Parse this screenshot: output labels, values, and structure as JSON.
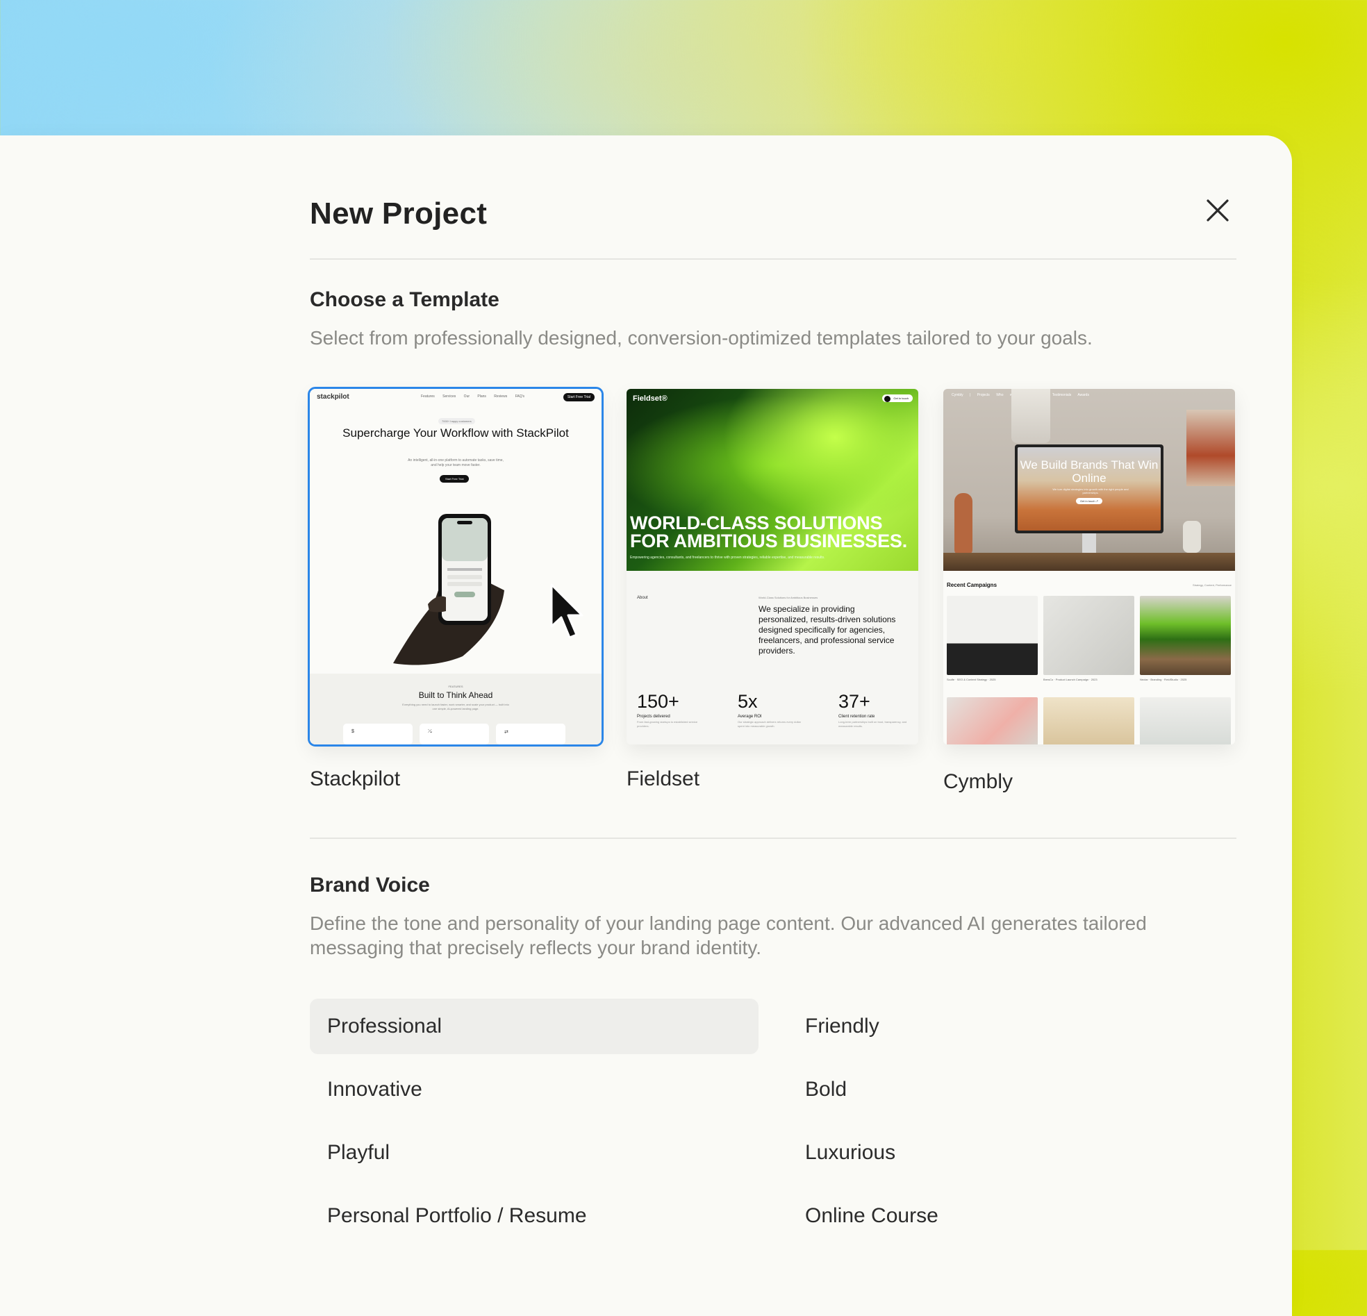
{
  "dialog": {
    "title": "New Project",
    "close_icon": "close-icon"
  },
  "templates_section": {
    "title": "Choose a Template",
    "description": "Select from professionally designed, conversion-optimized templates tailored to your goals.",
    "selected": "Stackpilot",
    "items": [
      {
        "name": "Stackpilot",
        "preview": {
          "logo": "stackpilot",
          "nav_links": "Features Services Our Plans Reviews FAQ's",
          "nav_cta": "Start Free Trial",
          "pill": "7000+ happy customers",
          "headline": "Supercharge Your Workflow with StackPilot",
          "subtext": "An intelligent, all-in-one platform to automate tasks, save time, and help your team move faster.",
          "button": "Start Free Trial",
          "features_tag": "FEATURES",
          "features_title": "Built to Think Ahead",
          "features_desc": "Everything you need to launch faster, work smarter, and scale your product — built into one simple, AI-powered landing page.",
          "feature_icons": [
            "$",
            "⤯",
            "⇄"
          ]
        }
      },
      {
        "name": "Fieldset",
        "preview": {
          "brand": "Fieldset®",
          "touch_button": "Get in touch",
          "headline": "WORLD-CLASS SOLUTIONS FOR AMBITIOUS BUSINESSES.",
          "tagline": "Empowering agencies, consultants, and freelancers to thrive with proven strategies, reliable expertise, and measurable results.",
          "about_label": "About",
          "about_mini": "World-Class Solutions for Ambitious Businesses",
          "about_text": "We specialize in providing personalized, results-driven solutions designed specifically for agencies, freelancers, and professional service providers.",
          "stats": [
            {
              "value": "150+",
              "label": "Projects delivered",
              "desc": "From fast-growing startups to established service providers."
            },
            {
              "value": "5x",
              "label": "Average ROI",
              "desc": "Our strategic approach delivers returns every dollar spent into measurable growth."
            },
            {
              "value": "37+",
              "label": "Client retention rate",
              "desc": "Long-term partnerships built on trust, transparency, and measurable results."
            }
          ]
        }
      },
      {
        "name": "Cymbly",
        "preview": {
          "nav": "Cymbly | Projects Who we are Services Testimonials Awards",
          "screen_headline": "We Build Brands That Win Online",
          "screen_sub": "We turn digital strategies into growth with the right people and partnerships.",
          "screen_button": "Get in touch ↗",
          "recent_label": "Recent Campaigns",
          "recent_meta": "Strategy, Content, Performance",
          "captions": [
            "Sculfe · SEO & Content Strategy · 2025",
            "BrewCo · Product Launch Campaign · 2023",
            "Nectar · Branding · FieldStudio · 2025"
          ]
        }
      }
    ]
  },
  "brand_voice": {
    "title": "Brand Voice",
    "description": "Define the tone and personality of your landing page content. Our advanced AI generates tailored messaging that precisely reflects your brand identity.",
    "selected": "Professional",
    "options": [
      "Professional",
      "Friendly",
      "Innovative",
      "Bold",
      "Playful",
      "Luxurious",
      "Personal Portfolio / Resume",
      "Online Course"
    ]
  },
  "colors": {
    "selection_outline": "#2b86e8",
    "selected_option_bg": "#eeeeeb"
  }
}
